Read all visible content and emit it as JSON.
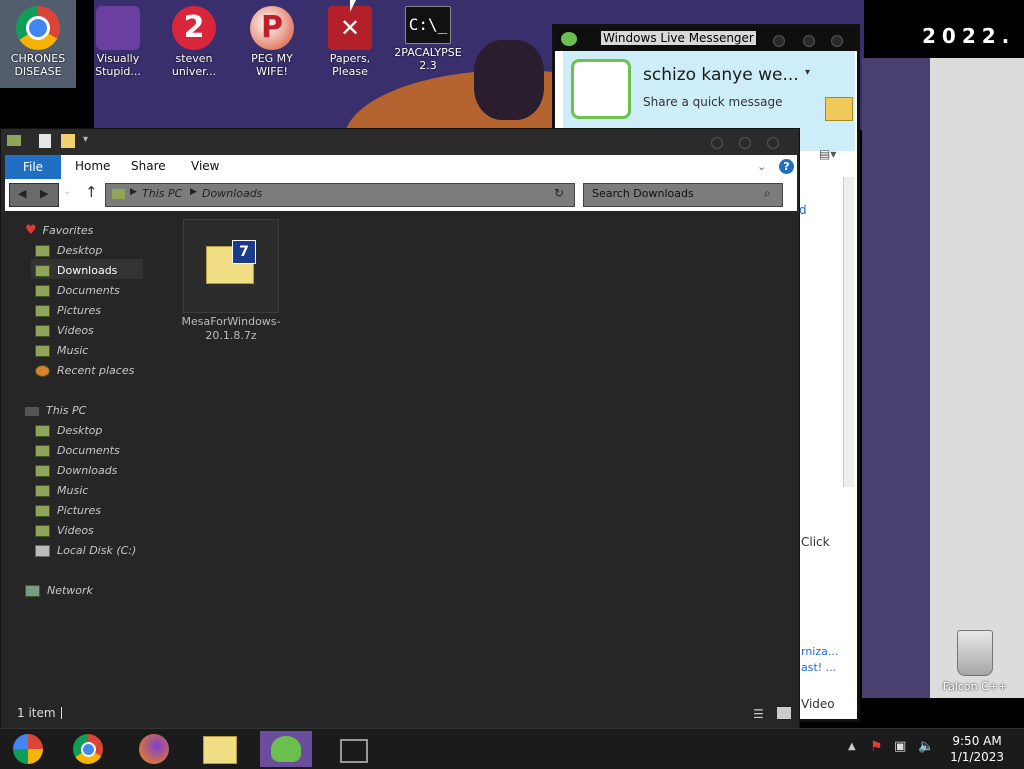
{
  "desktop": {
    "year_banner": "2022.",
    "icons": [
      {
        "label": "CHRONES DISEASE",
        "icon": "chrome-icon",
        "color": "#1a73e8"
      },
      {
        "label": "Visually Stupid...",
        "icon": "visual-studio-icon",
        "color": "#6b3fa0"
      },
      {
        "label": "steven univer...",
        "icon": "steven-universe-icon",
        "color": "#d9263b"
      },
      {
        "label": "PEG MY WIFE!",
        "icon": "p-ball-icon",
        "color": "#d94a2a"
      },
      {
        "label": "Papers, Please",
        "icon": "papers-please-icon",
        "color": "#b3202a"
      },
      {
        "label": "2PACALYPSE 2.3",
        "icon": "terminal-icon",
        "color": "#111111"
      }
    ],
    "recycle_bin_label": "Falcon C++"
  },
  "explorer": {
    "ribbon": {
      "file": "File",
      "home": "Home",
      "share": "Share",
      "view": "View"
    },
    "breadcrumb": [
      "This PC",
      "Downloads"
    ],
    "search_placeholder": "Search Downloads",
    "nav": {
      "favorites": "Favorites",
      "favorites_items": [
        "Desktop",
        "Downloads",
        "Documents",
        "Pictures",
        "Videos",
        "Music",
        "Recent places"
      ],
      "this_pc": "This PC",
      "pc_items": [
        "Desktop",
        "Documents",
        "Downloads",
        "Music",
        "Pictures",
        "Videos",
        "Local Disk (C:)"
      ],
      "network": "Network"
    },
    "file": {
      "name": "MesaForWindows-20.1.8.7z"
    },
    "status": "1 item"
  },
  "messenger": {
    "title": "Windows Live Messenger",
    "username": "schizo kanye we...",
    "share_message": "Share a quick message",
    "fragments": [
      "d",
      "Click",
      "rniza...",
      "ast! ...",
      "Video"
    ]
  },
  "taskbar": {
    "clock_time": "9:50 AM",
    "clock_date": "1/1/2023"
  }
}
